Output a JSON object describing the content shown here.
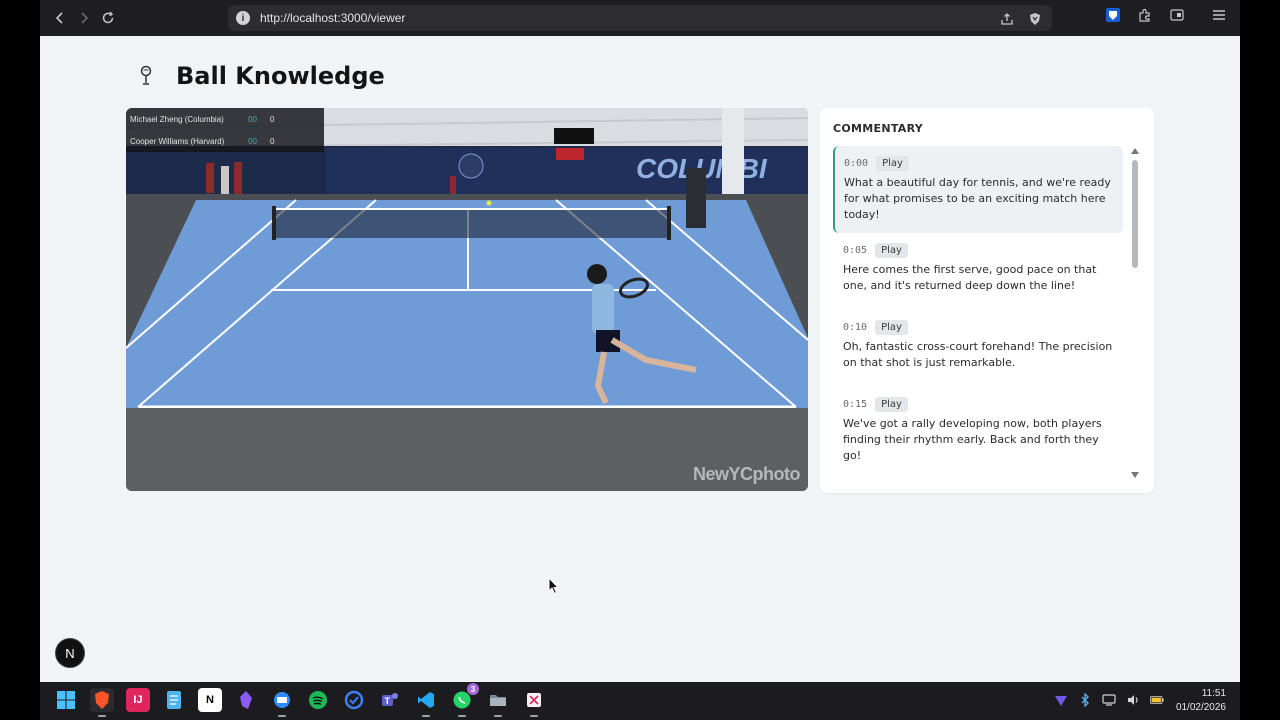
{
  "browser": {
    "url": "http://localhost:3000/viewer"
  },
  "app": {
    "title": "Ball Knowledge",
    "icon": "microphone-icon"
  },
  "video": {
    "scoreboard": {
      "players": [
        {
          "name": "Michael Zheng (Columbia)",
          "games": "00",
          "points": "0"
        },
        {
          "name": "Cooper Williams (Harvard)",
          "games": "00",
          "points": "0"
        }
      ]
    },
    "watermark": "NewYCphoto"
  },
  "commentary": {
    "heading": "COMMENTARY",
    "items": [
      {
        "time": "0:00",
        "play_label": "Play",
        "text": "What a beautiful day for tennis, and we're ready for what promises to be an exciting match here today!",
        "active": true
      },
      {
        "time": "0:05",
        "play_label": "Play",
        "text": "Here comes the first serve, good pace on that one, and it's returned deep down the line!"
      },
      {
        "time": "0:10",
        "play_label": "Play",
        "text": "Oh, fantastic cross-court forehand! The precision on that shot is just remarkable."
      },
      {
        "time": "0:15",
        "play_label": "Play",
        "text": "We've got a rally developing now, both players finding their rhythm early. Back and forth they go!"
      }
    ]
  },
  "dev_badge": "N",
  "taskbar": {
    "clock_time": "11:51",
    "clock_date": "01/02/2026",
    "whatsapp_badge": "3"
  },
  "colors": {
    "accent": "#2aa078",
    "page_bg": "#f1f4f6"
  }
}
